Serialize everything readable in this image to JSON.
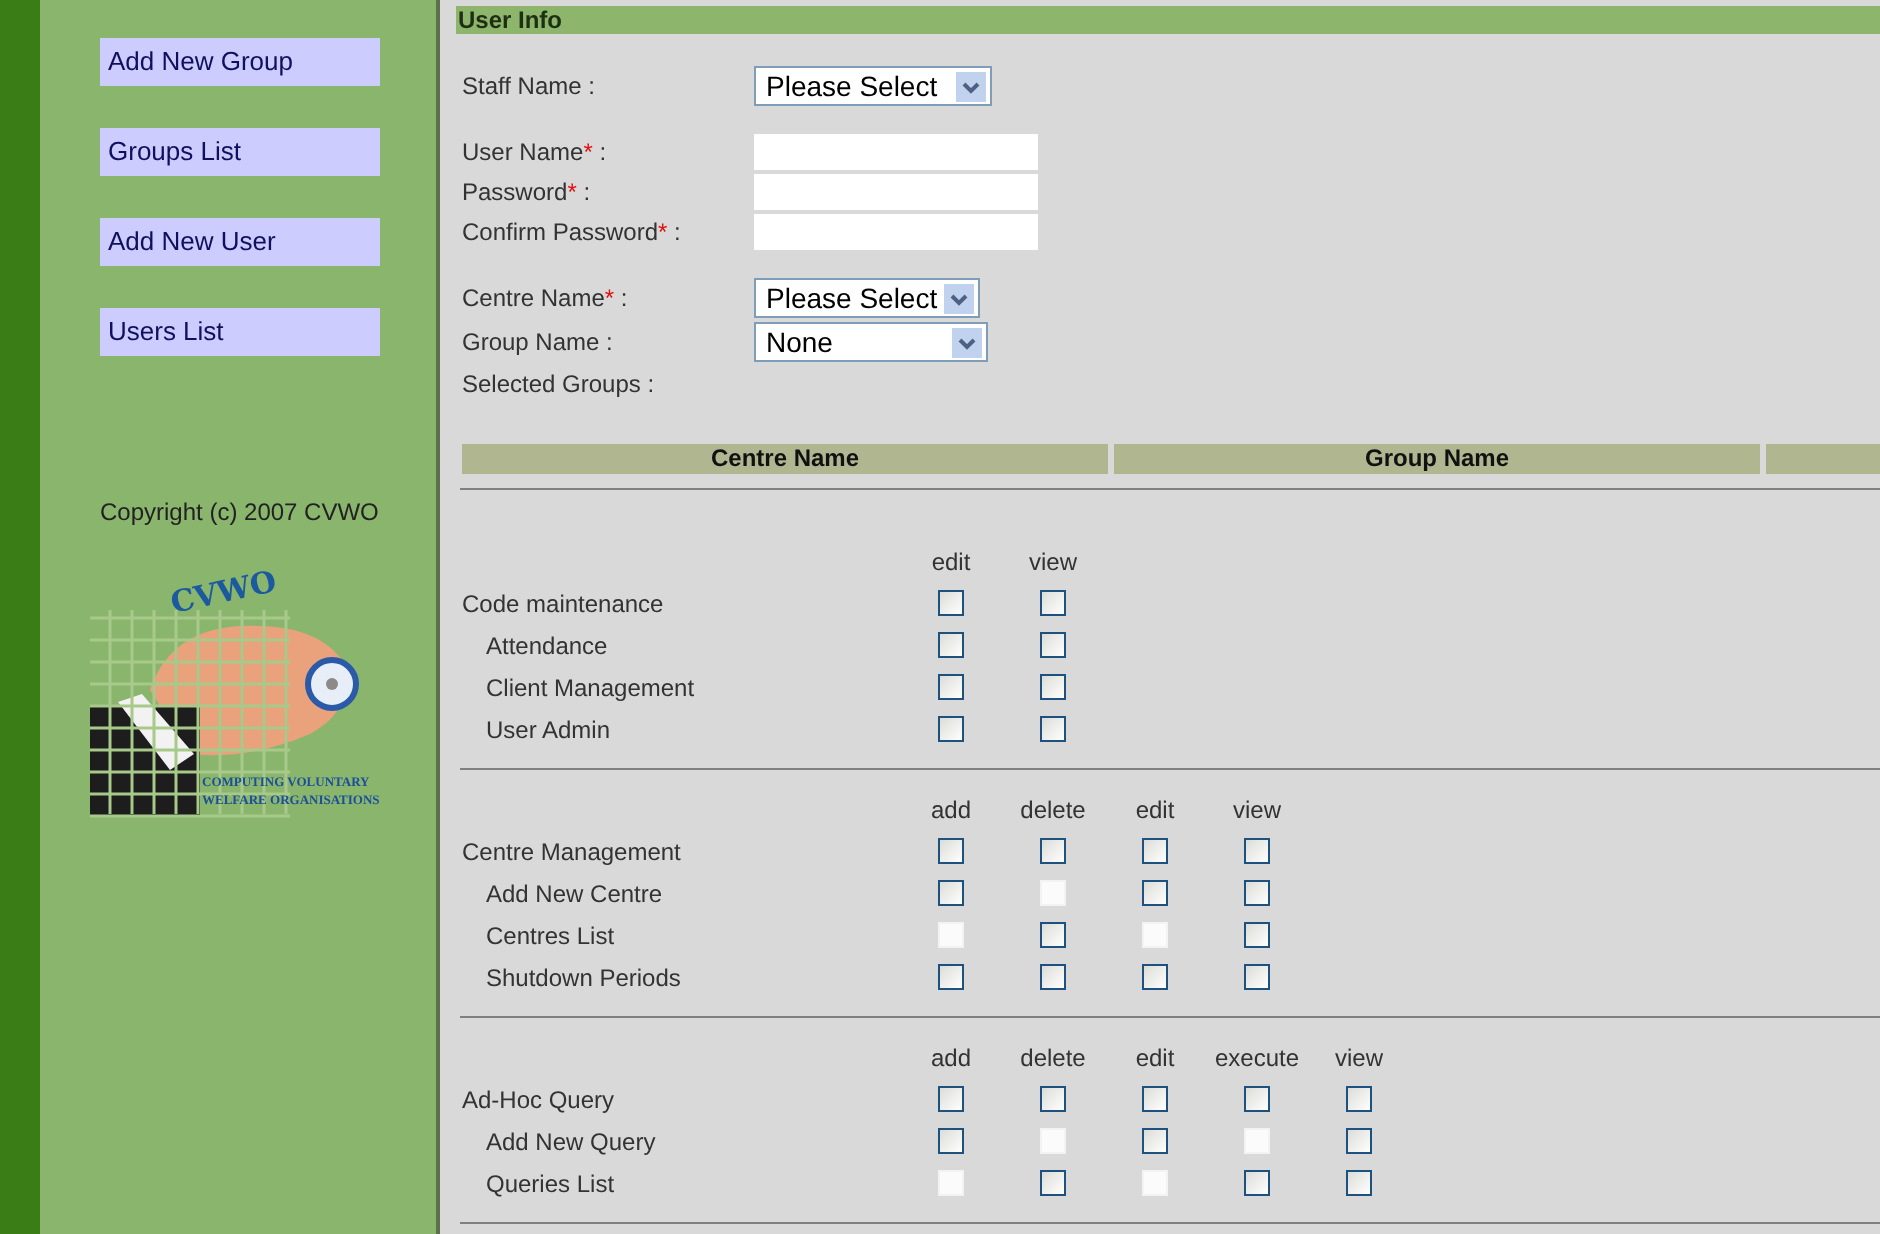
{
  "sidebar": {
    "items": [
      {
        "label": "Add New Group"
      },
      {
        "label": "Groups List"
      },
      {
        "label": "Add New User"
      },
      {
        "label": "Users List"
      }
    ],
    "copyright": "Copyright (c) 2007 CVWO",
    "logo": {
      "title": "CVWO",
      "tagline_1": "COMPUTING VOLUNTARY",
      "tagline_2": "WELFARE ORGANISATIONS"
    }
  },
  "section_title": "User Info",
  "form": {
    "groups": [
      [
        {
          "kind": "select",
          "label": "Staff Name :",
          "value": "Please Select"
        }
      ],
      [
        {
          "kind": "text",
          "label": "User Name",
          "mark": "*",
          "suffix": " :"
        },
        {
          "kind": "text",
          "label": "Password",
          "mark": "*",
          "suffix": " :"
        },
        {
          "kind": "text",
          "label": "Confirm Password",
          "mark": "*",
          "suffix": " :"
        }
      ],
      [
        {
          "kind": "select",
          "label": "Centre Name",
          "mark": "*",
          "suffix": " :",
          "value": "Please Select"
        },
        {
          "kind": "select",
          "label": "Group Name :",
          "value": "None"
        },
        {
          "kind": "static",
          "label": "Selected Groups :"
        }
      ]
    ]
  },
  "groups_table": {
    "columns": [
      "Centre Name",
      "Group Name"
    ]
  },
  "permissions": [
    {
      "columns": [
        "edit",
        "view"
      ],
      "module": {
        "label": "Code maintenance",
        "cells": [
          {
            "disabled": false,
            "checked": false
          },
          {
            "disabled": false,
            "checked": false
          }
        ]
      },
      "children": [
        {
          "label": "Attendance",
          "cells": [
            {
              "disabled": false,
              "checked": false
            },
            {
              "disabled": false,
              "checked": false
            }
          ]
        },
        {
          "label": "Client Management",
          "cells": [
            {
              "disabled": false,
              "checked": false
            },
            {
              "disabled": false,
              "checked": false
            }
          ]
        },
        {
          "label": "User Admin",
          "cells": [
            {
              "disabled": false,
              "checked": false
            },
            {
              "disabled": false,
              "checked": false
            }
          ]
        }
      ]
    },
    {
      "columns": [
        "add",
        "delete",
        "edit",
        "view"
      ],
      "module": {
        "label": "Centre Management",
        "cells": [
          {
            "disabled": false,
            "checked": false
          },
          {
            "disabled": false,
            "checked": false
          },
          {
            "disabled": false,
            "checked": false
          },
          {
            "disabled": false,
            "checked": false
          }
        ]
      },
      "children": [
        {
          "label": "Add New Centre",
          "cells": [
            {
              "disabled": false,
              "checked": false
            },
            {
              "disabled": true,
              "checked": false
            },
            {
              "disabled": false,
              "checked": false
            },
            {
              "disabled": false,
              "checked": false
            }
          ]
        },
        {
          "label": "Centres List",
          "cells": [
            {
              "disabled": true,
              "checked": false
            },
            {
              "disabled": false,
              "checked": false
            },
            {
              "disabled": true,
              "checked": false
            },
            {
              "disabled": false,
              "checked": false
            }
          ]
        },
        {
          "label": "Shutdown Periods",
          "cells": [
            {
              "disabled": false,
              "checked": false
            },
            {
              "disabled": false,
              "checked": false
            },
            {
              "disabled": false,
              "checked": false
            },
            {
              "disabled": false,
              "checked": false
            }
          ]
        }
      ]
    },
    {
      "columns": [
        "add",
        "delete",
        "edit",
        "execute",
        "view"
      ],
      "module": {
        "label": "Ad-Hoc Query",
        "cells": [
          {
            "disabled": false,
            "checked": false
          },
          {
            "disabled": false,
            "checked": false
          },
          {
            "disabled": false,
            "checked": false
          },
          {
            "disabled": false,
            "checked": false
          },
          {
            "disabled": false,
            "checked": false
          }
        ]
      },
      "children": [
        {
          "label": "Add New Query",
          "cells": [
            {
              "disabled": false,
              "checked": false
            },
            {
              "disabled": true,
              "checked": false
            },
            {
              "disabled": false,
              "checked": false
            },
            {
              "disabled": true,
              "checked": false
            },
            {
              "disabled": false,
              "checked": false
            }
          ]
        },
        {
          "label": "Queries List",
          "cells": [
            {
              "disabled": true,
              "checked": false
            },
            {
              "disabled": false,
              "checked": false
            },
            {
              "disabled": true,
              "checked": false
            },
            {
              "disabled": false,
              "checked": false
            },
            {
              "disabled": false,
              "checked": false
            }
          ]
        }
      ]
    }
  ]
}
